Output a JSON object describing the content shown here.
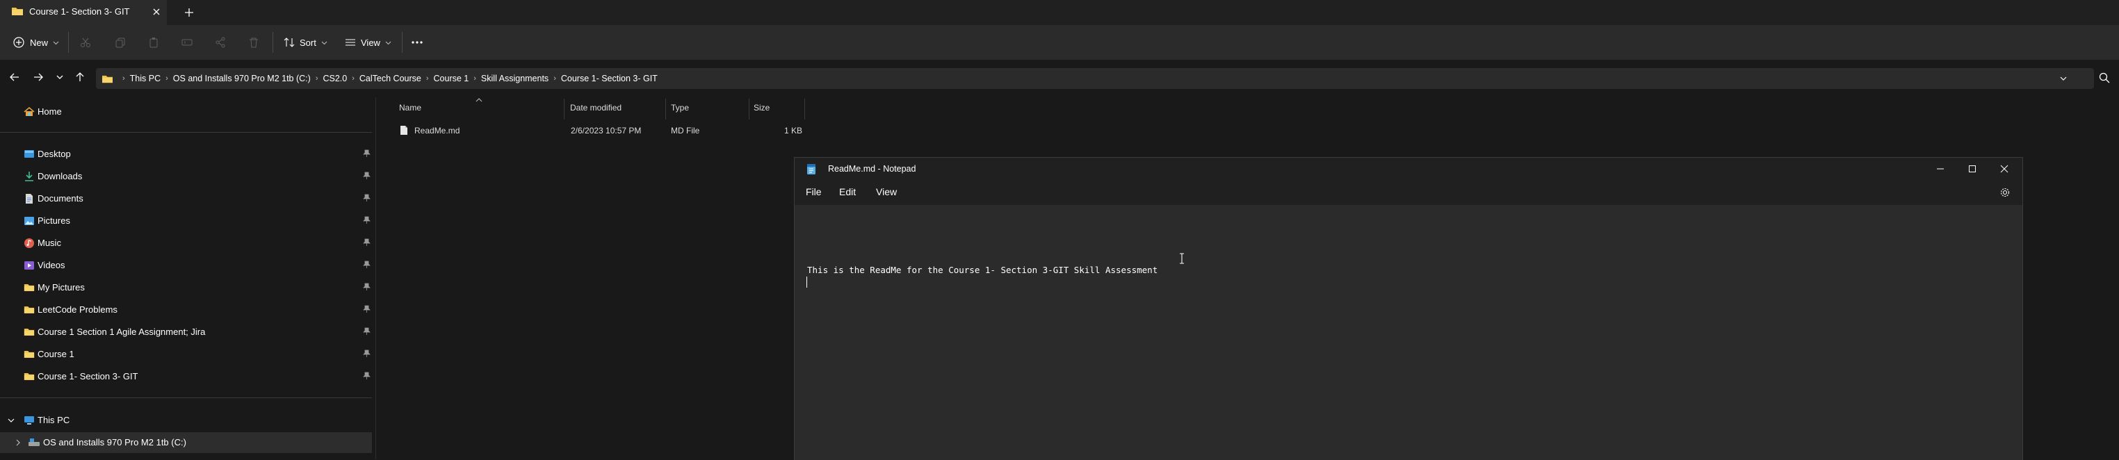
{
  "tab": {
    "title": "Course 1- Section 3- GIT"
  },
  "toolbar": {
    "new_label": "New",
    "sort_label": "Sort",
    "view_label": "View"
  },
  "address": {
    "crumbs": [
      "This PC",
      "OS and Installs 970 Pro M2 1tb (C:)",
      "CS2.0",
      "CalTech Course",
      "Course 1",
      "Skill Assignments",
      "Course 1- Section 3- GIT"
    ]
  },
  "nav": {
    "home": "Home",
    "quick_access": [
      {
        "label": "Desktop",
        "icon": "desktop-icon"
      },
      {
        "label": "Downloads",
        "icon": "downloads-icon"
      },
      {
        "label": "Documents",
        "icon": "documents-icon"
      },
      {
        "label": "Pictures",
        "icon": "pictures-icon"
      },
      {
        "label": "Music",
        "icon": "music-icon"
      },
      {
        "label": "Videos",
        "icon": "videos-icon"
      },
      {
        "label": "My Pictures",
        "icon": "folder-icon"
      },
      {
        "label": "LeetCode Problems",
        "icon": "folder-icon"
      },
      {
        "label": "Course 1 Section 1 Agile Assignment; Jira",
        "icon": "folder-icon"
      },
      {
        "label": "Course 1",
        "icon": "folder-icon"
      },
      {
        "label": "Course 1- Section 3- GIT",
        "icon": "folder-icon"
      }
    ],
    "this_pc": "This PC",
    "drive": "OS and Installs 970 Pro M2 1tb (C:)"
  },
  "columns": {
    "name": "Name",
    "date": "Date modified",
    "type": "Type",
    "size": "Size"
  },
  "files": [
    {
      "name": "ReadMe.md",
      "date": "2/6/2023 10:57 PM",
      "type": "MD File",
      "size": "1 KB"
    }
  ],
  "notepad": {
    "title": "ReadMe.md - Notepad",
    "menu": {
      "file": "File",
      "edit": "Edit",
      "view": "View"
    },
    "content": "This is the ReadMe for the Course 1- Section 3-GIT Skill Assessment"
  },
  "colors": {
    "accent": "#60cdff",
    "folder": "#f0c24a",
    "background": "#191919",
    "panel": "#2b2b2b"
  }
}
